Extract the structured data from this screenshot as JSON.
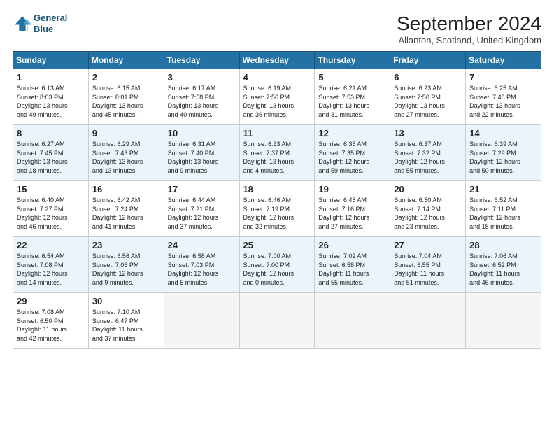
{
  "header": {
    "logo_line1": "General",
    "logo_line2": "Blue",
    "month_title": "September 2024",
    "location": "Allanton, Scotland, United Kingdom"
  },
  "weekdays": [
    "Sunday",
    "Monday",
    "Tuesday",
    "Wednesday",
    "Thursday",
    "Friday",
    "Saturday"
  ],
  "weeks": [
    [
      {
        "day": "1",
        "info": "Sunrise: 6:13 AM\nSunset: 8:03 PM\nDaylight: 13 hours\nand 49 minutes."
      },
      {
        "day": "2",
        "info": "Sunrise: 6:15 AM\nSunset: 8:01 PM\nDaylight: 13 hours\nand 45 minutes."
      },
      {
        "day": "3",
        "info": "Sunrise: 6:17 AM\nSunset: 7:58 PM\nDaylight: 13 hours\nand 40 minutes."
      },
      {
        "day": "4",
        "info": "Sunrise: 6:19 AM\nSunset: 7:56 PM\nDaylight: 13 hours\nand 36 minutes."
      },
      {
        "day": "5",
        "info": "Sunrise: 6:21 AM\nSunset: 7:53 PM\nDaylight: 13 hours\nand 31 minutes."
      },
      {
        "day": "6",
        "info": "Sunrise: 6:23 AM\nSunset: 7:50 PM\nDaylight: 13 hours\nand 27 minutes."
      },
      {
        "day": "7",
        "info": "Sunrise: 6:25 AM\nSunset: 7:48 PM\nDaylight: 13 hours\nand 22 minutes."
      }
    ],
    [
      {
        "day": "8",
        "info": "Sunrise: 6:27 AM\nSunset: 7:45 PM\nDaylight: 13 hours\nand 18 minutes."
      },
      {
        "day": "9",
        "info": "Sunrise: 6:29 AM\nSunset: 7:43 PM\nDaylight: 13 hours\nand 13 minutes."
      },
      {
        "day": "10",
        "info": "Sunrise: 6:31 AM\nSunset: 7:40 PM\nDaylight: 13 hours\nand 9 minutes."
      },
      {
        "day": "11",
        "info": "Sunrise: 6:33 AM\nSunset: 7:37 PM\nDaylight: 13 hours\nand 4 minutes."
      },
      {
        "day": "12",
        "info": "Sunrise: 6:35 AM\nSunset: 7:35 PM\nDaylight: 12 hours\nand 59 minutes."
      },
      {
        "day": "13",
        "info": "Sunrise: 6:37 AM\nSunset: 7:32 PM\nDaylight: 12 hours\nand 55 minutes."
      },
      {
        "day": "14",
        "info": "Sunrise: 6:39 AM\nSunset: 7:29 PM\nDaylight: 12 hours\nand 50 minutes."
      }
    ],
    [
      {
        "day": "15",
        "info": "Sunrise: 6:40 AM\nSunset: 7:27 PM\nDaylight: 12 hours\nand 46 minutes."
      },
      {
        "day": "16",
        "info": "Sunrise: 6:42 AM\nSunset: 7:24 PM\nDaylight: 12 hours\nand 41 minutes."
      },
      {
        "day": "17",
        "info": "Sunrise: 6:44 AM\nSunset: 7:21 PM\nDaylight: 12 hours\nand 37 minutes."
      },
      {
        "day": "18",
        "info": "Sunrise: 6:46 AM\nSunset: 7:19 PM\nDaylight: 12 hours\nand 32 minutes."
      },
      {
        "day": "19",
        "info": "Sunrise: 6:48 AM\nSunset: 7:16 PM\nDaylight: 12 hours\nand 27 minutes."
      },
      {
        "day": "20",
        "info": "Sunrise: 6:50 AM\nSunset: 7:14 PM\nDaylight: 12 hours\nand 23 minutes."
      },
      {
        "day": "21",
        "info": "Sunrise: 6:52 AM\nSunset: 7:11 PM\nDaylight: 12 hours\nand 18 minutes."
      }
    ],
    [
      {
        "day": "22",
        "info": "Sunrise: 6:54 AM\nSunset: 7:08 PM\nDaylight: 12 hours\nand 14 minutes."
      },
      {
        "day": "23",
        "info": "Sunrise: 6:56 AM\nSunset: 7:06 PM\nDaylight: 12 hours\nand 9 minutes."
      },
      {
        "day": "24",
        "info": "Sunrise: 6:58 AM\nSunset: 7:03 PM\nDaylight: 12 hours\nand 5 minutes."
      },
      {
        "day": "25",
        "info": "Sunrise: 7:00 AM\nSunset: 7:00 PM\nDaylight: 12 hours\nand 0 minutes."
      },
      {
        "day": "26",
        "info": "Sunrise: 7:02 AM\nSunset: 6:58 PM\nDaylight: 11 hours\nand 55 minutes."
      },
      {
        "day": "27",
        "info": "Sunrise: 7:04 AM\nSunset: 6:55 PM\nDaylight: 11 hours\nand 51 minutes."
      },
      {
        "day": "28",
        "info": "Sunrise: 7:06 AM\nSunset: 6:52 PM\nDaylight: 11 hours\nand 46 minutes."
      }
    ],
    [
      {
        "day": "29",
        "info": "Sunrise: 7:08 AM\nSunset: 6:50 PM\nDaylight: 11 hours\nand 42 minutes."
      },
      {
        "day": "30",
        "info": "Sunrise: 7:10 AM\nSunset: 6:47 PM\nDaylight: 11 hours\nand 37 minutes."
      },
      null,
      null,
      null,
      null,
      null
    ]
  ]
}
